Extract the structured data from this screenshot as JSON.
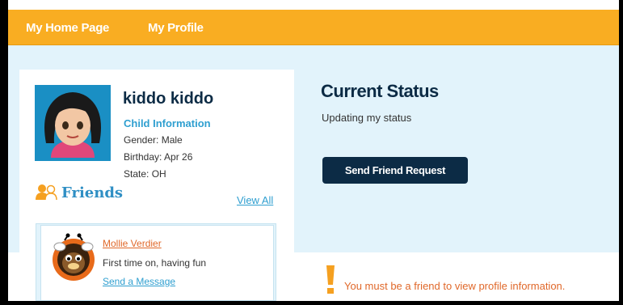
{
  "nav": {
    "home_label": "My Home Page",
    "profile_label": "My Profile",
    "accent": "#f9ad22"
  },
  "profile": {
    "name": "kiddo kiddo",
    "info_heading": "Child Information",
    "gender": "Gender: Male",
    "birthday": "Birthday: Apr 26",
    "state": "State: OH"
  },
  "friends": {
    "title": "Friends",
    "view_all": "View All",
    "items": [
      {
        "name": "Mollie Verdier",
        "status": "First time on, having fun",
        "action": "Send a Message"
      }
    ]
  },
  "status": {
    "title": "Current Status",
    "text": "Updating my status",
    "button_label": "Send Friend Request"
  },
  "notice": {
    "text": "You must be a friend to view profile information.",
    "color": "#e0682a"
  },
  "colors": {
    "navy": "#0c2b45",
    "light_blue": "#e2f3fb",
    "link_blue": "#2f9fd0"
  },
  "icons": {
    "friends": "friends-icon",
    "warning": "exclamation-icon"
  }
}
